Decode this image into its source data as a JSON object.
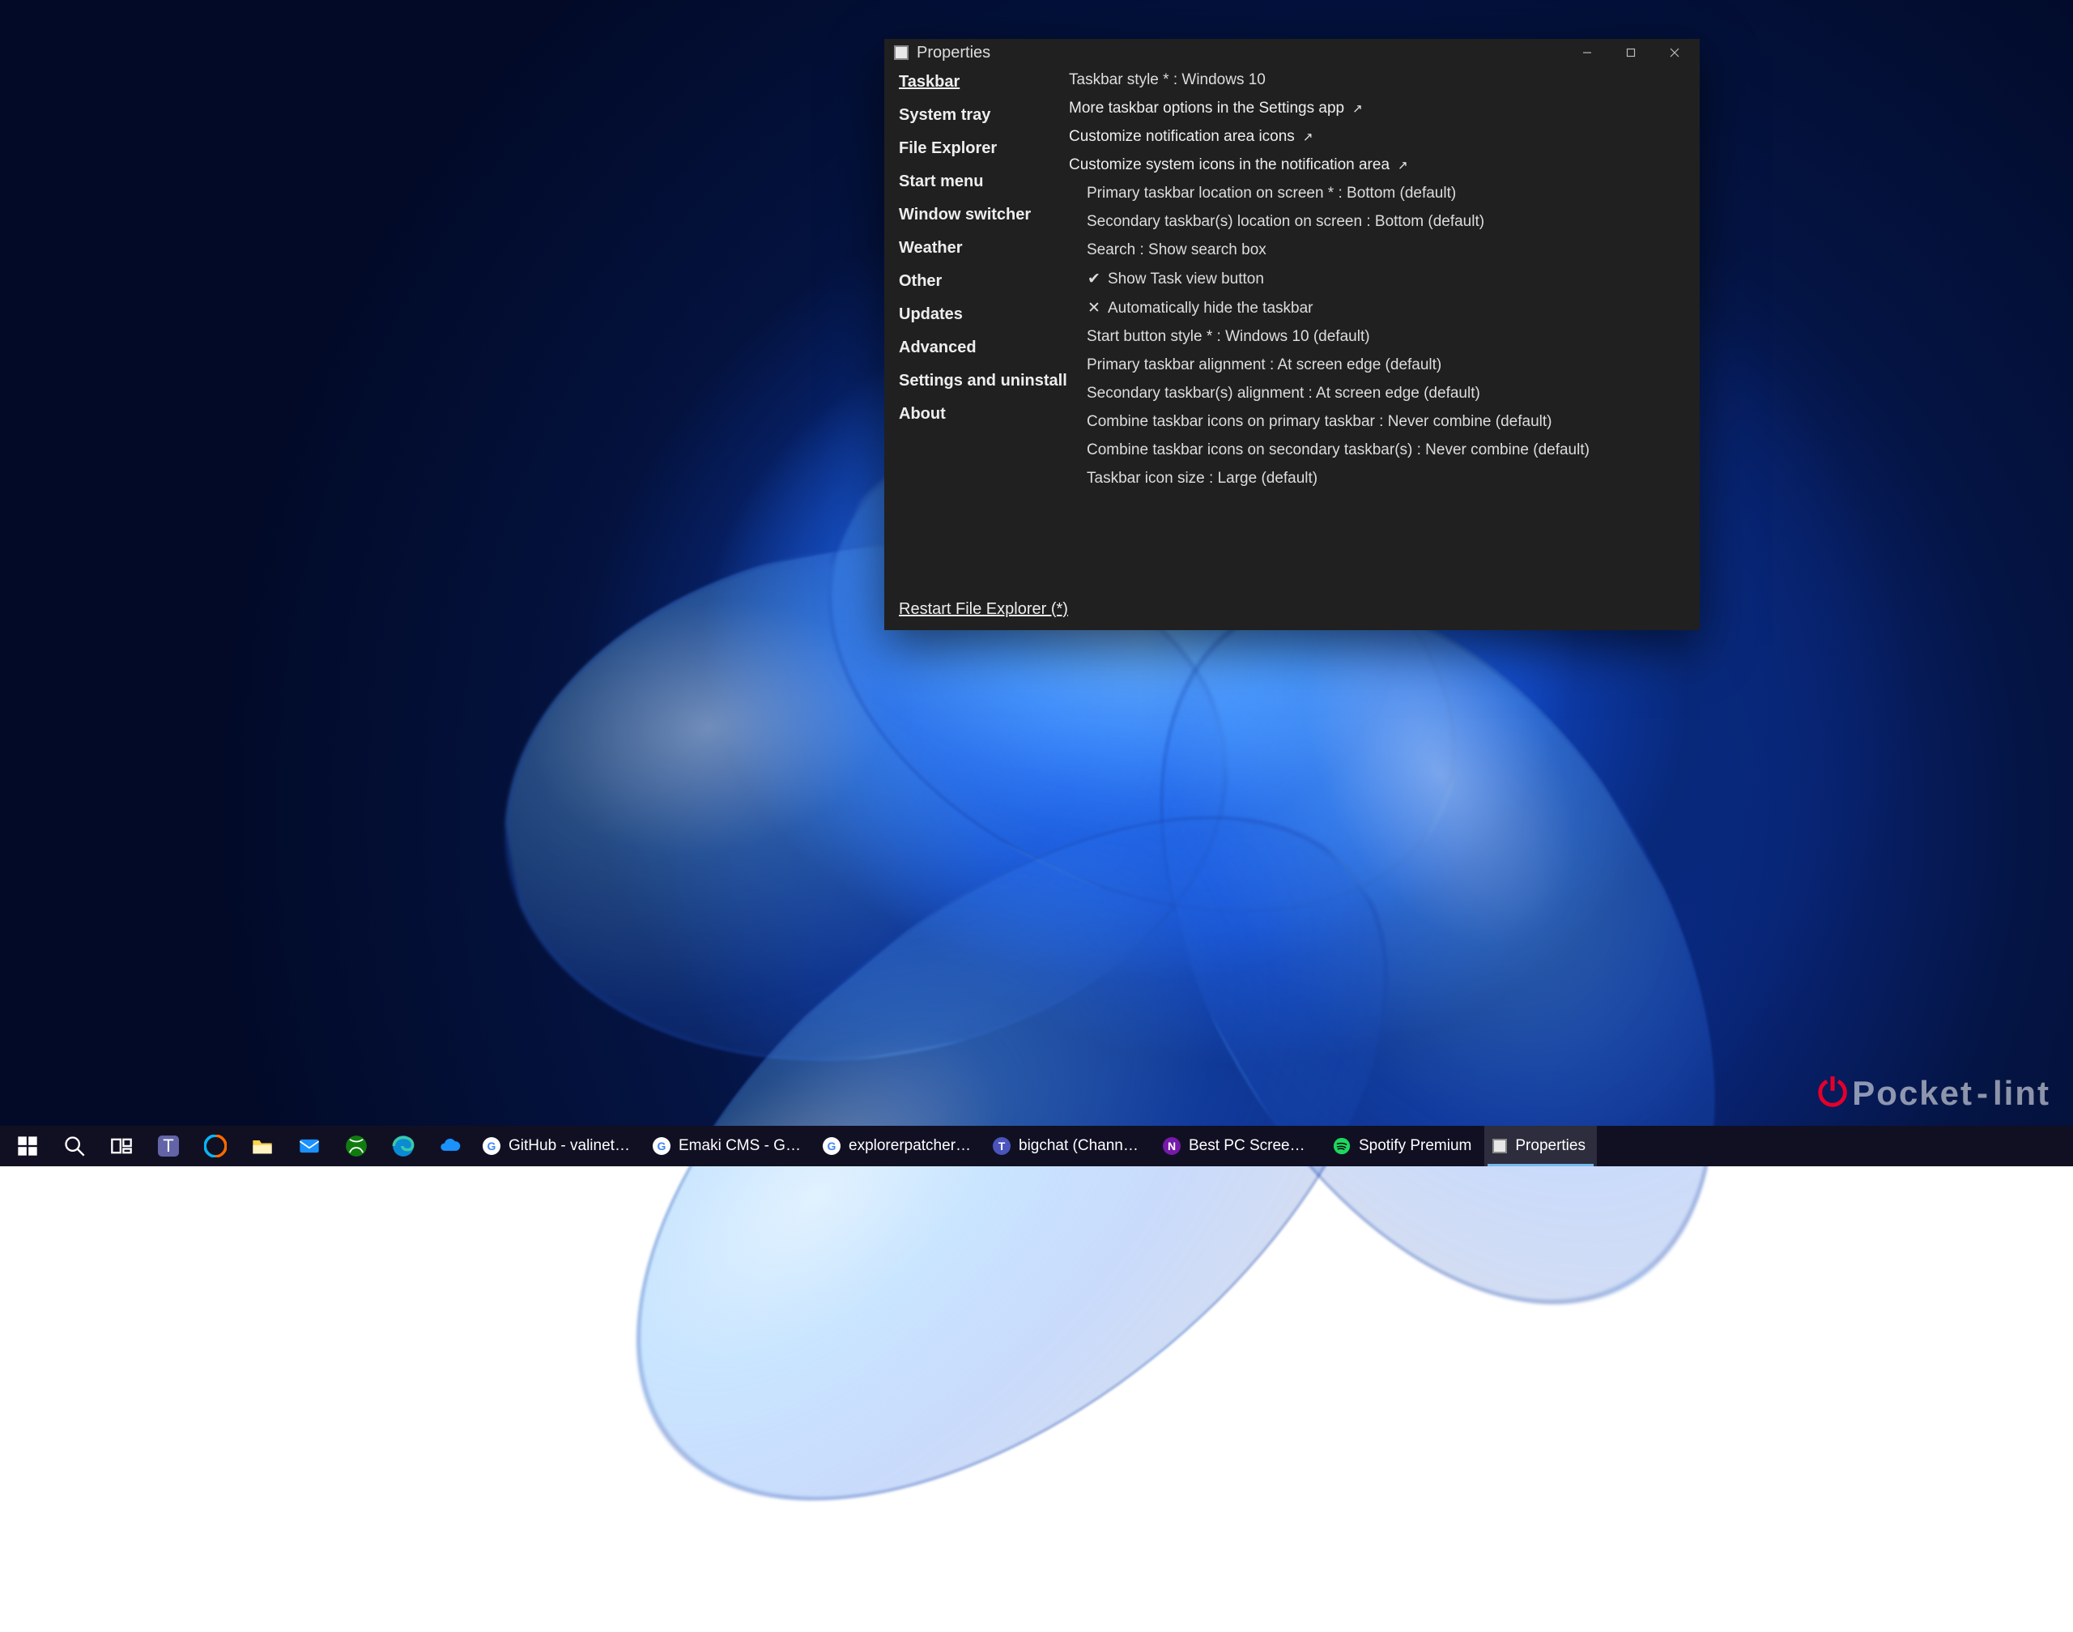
{
  "window": {
    "title": "Properties",
    "restart": "Restart File Explorer (*)"
  },
  "sidebar": {
    "items": [
      "Taskbar",
      "System tray",
      "File Explorer",
      "Start menu",
      "Window switcher",
      "Weather",
      "Other",
      "Updates",
      "Advanced",
      "Settings and uninstall",
      "About"
    ],
    "activeIndex": 0
  },
  "content": {
    "rows": [
      {
        "text": "Taskbar style * : Windows 10",
        "indent": false,
        "link": false,
        "check": null
      },
      {
        "text": "More taskbar options in the Settings app",
        "indent": false,
        "link": true,
        "check": null
      },
      {
        "text": "Customize notification area icons",
        "indent": false,
        "link": true,
        "check": null
      },
      {
        "text": "Customize system icons in the notification area",
        "indent": false,
        "link": true,
        "check": null
      },
      {
        "text": "Primary taskbar location on screen * : Bottom (default)",
        "indent": true,
        "link": false,
        "check": null
      },
      {
        "text": "Secondary taskbar(s) location on screen : Bottom (default)",
        "indent": true,
        "link": false,
        "check": null
      },
      {
        "text": "Search : Show search box",
        "indent": true,
        "link": false,
        "check": null
      },
      {
        "text": "Show Task view button",
        "indent": true,
        "link": false,
        "check": true
      },
      {
        "text": "Automatically hide the taskbar",
        "indent": true,
        "link": false,
        "check": false
      },
      {
        "text": "Start button style * : Windows 10 (default)",
        "indent": true,
        "link": false,
        "check": null
      },
      {
        "text": "Primary taskbar alignment : At screen edge (default)",
        "indent": true,
        "link": false,
        "check": null
      },
      {
        "text": "Secondary taskbar(s) alignment : At screen edge (default)",
        "indent": true,
        "link": false,
        "check": null
      },
      {
        "text": "Combine taskbar icons on primary taskbar : Never combine (default)",
        "indent": true,
        "link": false,
        "check": null
      },
      {
        "text": "Combine taskbar icons on secondary taskbar(s) : Never combine (default)",
        "indent": true,
        "link": false,
        "check": null
      },
      {
        "text": "Taskbar icon size : Large (default)",
        "indent": true,
        "link": false,
        "check": null
      }
    ]
  },
  "taskbar": {
    "pinned": [
      {
        "name": "start",
        "color": "#ffffff"
      },
      {
        "name": "search",
        "color": "#ffffff"
      },
      {
        "name": "task-view",
        "color": "#ffffff"
      },
      {
        "name": "teams",
        "color": "#6264a7"
      },
      {
        "name": "copilot",
        "color": "#00b7ff"
      },
      {
        "name": "file-explorer",
        "color": "#ffd24a"
      },
      {
        "name": "mail",
        "color": "#1a91ff"
      },
      {
        "name": "xbox",
        "color": "#107c10"
      },
      {
        "name": "edge",
        "color": "#0b8bd4"
      },
      {
        "name": "onedrive",
        "color": "#1a91ff"
      }
    ],
    "running": [
      {
        "label": "GitHub - valinet/Ex…",
        "favBg": "#ffffff",
        "favFg": "#4285f4",
        "favText": "G",
        "icon": "chrome"
      },
      {
        "label": "Emaki CMS - Googl…",
        "favBg": "#ffffff",
        "favFg": "#4285f4",
        "favText": "G",
        "icon": "chrome"
      },
      {
        "label": "explorerpatcher - G…",
        "favBg": "#ffffff",
        "favFg": "#4285f4",
        "favText": "G",
        "icon": "chrome"
      },
      {
        "label": "bigchat (Channel) -…",
        "favBg": "#4b53bc",
        "favFg": "#ffffff",
        "favText": "T",
        "icon": "teams"
      },
      {
        "label": "Best PC Screen Rec…",
        "favBg": "#7719aa",
        "favFg": "#ffffff",
        "favText": "N",
        "icon": "onenote"
      },
      {
        "label": "Spotify Premium",
        "favBg": "#1ed760",
        "favFg": "#000000",
        "favText": "",
        "icon": "spotify"
      },
      {
        "label": "Properties",
        "favBg": "#e8e8e8",
        "favFg": "#444444",
        "favText": "",
        "icon": "props",
        "active": true
      }
    ]
  },
  "watermark": {
    "brand": "Pocket",
    "suffix": "lint"
  }
}
